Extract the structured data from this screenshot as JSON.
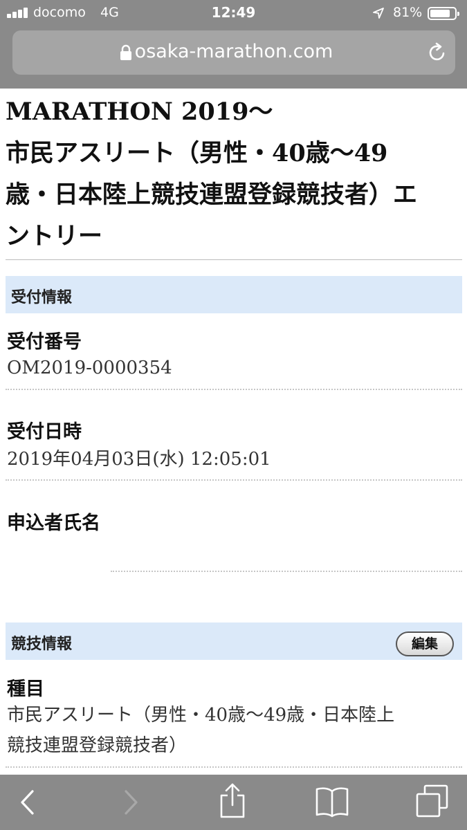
{
  "status_bar": {
    "carrier": "docomo",
    "network": "4G",
    "time": "12:49",
    "battery_percent": "81%",
    "battery_level": 0.81
  },
  "address_bar": {
    "url": "osaka-marathon.com"
  },
  "page": {
    "title_lines": [
      "MARATHON 2019〜",
      "市民アスリート（男性・40歳〜49",
      "歳・日本陸上競技連盟登録競技者）エ",
      "ントリー"
    ]
  },
  "reception": {
    "header": "受付情報",
    "number_label": "受付番号",
    "number_value": "OM2019-0000354",
    "datetime_label": "受付日時",
    "datetime_value": "2019年04月03日(水) 12:05:01",
    "applicant_label": "申込者氏名",
    "applicant_value": ""
  },
  "competition": {
    "header": "競技情報",
    "edit_label": "編集",
    "event_label": "種目",
    "event_value_lines": [
      "市民アスリート（男性・40歳〜49歳・日本陸上",
      "競技連盟登録競技者）"
    ]
  },
  "toolbar": {
    "icons": [
      "back-icon",
      "forward-icon",
      "share-icon",
      "bookmarks-icon",
      "tabs-icon"
    ]
  }
}
